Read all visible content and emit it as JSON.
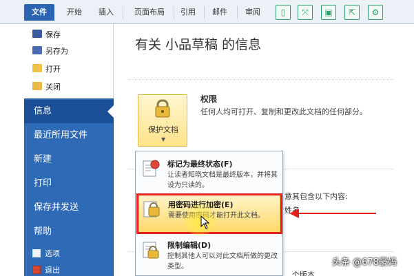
{
  "ribbon": {
    "tabs": [
      "文件",
      "开始",
      "插入",
      "页面布局",
      "引用",
      "邮件",
      "审阅"
    ],
    "quick_icons": [
      "mobile-icon",
      "fullscreen-icon",
      "save-icon",
      "share-icon",
      "settings-icon"
    ]
  },
  "nav": {
    "commands": [
      {
        "label": "保存",
        "icon": "save-icon"
      },
      {
        "label": "另存为",
        "icon": "save-as-icon"
      },
      {
        "label": "打开",
        "icon": "open-folder-icon"
      },
      {
        "label": "关闭",
        "icon": "close-folder-icon"
      }
    ],
    "items": [
      "信息",
      "最近所用文件",
      "新建",
      "打印",
      "保存并发送",
      "帮助"
    ],
    "active": "信息",
    "small": [
      {
        "label": "选项",
        "icon": "options-icon"
      },
      {
        "label": "退出",
        "icon": "exit-icon"
      }
    ]
  },
  "main": {
    "title": "有关 小品草稿 的信息",
    "protect_button_label": "保护文档",
    "permissions": {
      "title": "权限",
      "description": "任何人均可打开、复制和更改此文档的任何部分。"
    },
    "fragment_1": "意其包含以下内容:",
    "fragment_2": "姓名",
    "fragment_3": "个版本"
  },
  "menu": {
    "items": [
      {
        "title": "标记为最终状态(F)",
        "desc": "让读者知晓文档是最终版本，并将其设为只读的。",
        "icon": "final-mark-icon"
      },
      {
        "title": "用密码进行加密(E)",
        "desc": "需要使用密码才能打开此文档。",
        "icon": "encrypt-lock-icon"
      },
      {
        "title": "限制编辑(D)",
        "desc": "控制其他人可以对此文档所做的更改类型。",
        "icon": "restrict-edit-icon"
      }
    ],
    "highlighted": 1
  },
  "watermark": "头条 @678豪妈",
  "colors": {
    "file_tab": "#2b64b3",
    "nav_bg": "#2f6ab7",
    "highlight": "#ffd96a",
    "annotation_red": "#e3201b"
  }
}
